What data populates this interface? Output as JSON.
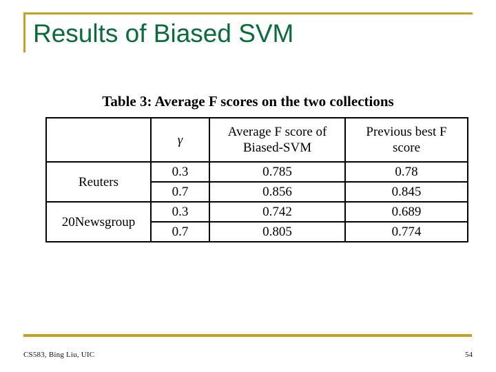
{
  "slide": {
    "title": "Results of Biased SVM",
    "title_color": "#0b6b3a",
    "accent_color": "#c4a023",
    "background_color": "#ffffff"
  },
  "figure": {
    "caption": "Table 3: Average F scores on the two collections",
    "table": {
      "headers": [
        "",
        "γ",
        "Average F score of Biased-SVM",
        "Previous best F score"
      ],
      "header_cells": {
        "col1": "",
        "col2": "γ",
        "col3_line1": "Average F score of",
        "col3_line2": "Biased-SVM",
        "col4_line1": "Previous best F",
        "col4_line2": "score"
      },
      "groups": [
        {
          "label": "Reuters",
          "rows": [
            {
              "gamma": "0.3",
              "biased_svm": "0.785",
              "previous_best": "0.78"
            },
            {
              "gamma": "0.7",
              "biased_svm": "0.856",
              "previous_best": "0.845"
            }
          ]
        },
        {
          "label": "20Newsgroup",
          "rows": [
            {
              "gamma": "0.3",
              "biased_svm": "0.742",
              "previous_best": "0.689"
            },
            {
              "gamma": "0.7",
              "biased_svm": "0.805",
              "previous_best": "0.774"
            }
          ]
        }
      ]
    }
  },
  "footer": {
    "credit": "CS583, Bing Liu, UIC",
    "page_number": "54"
  }
}
